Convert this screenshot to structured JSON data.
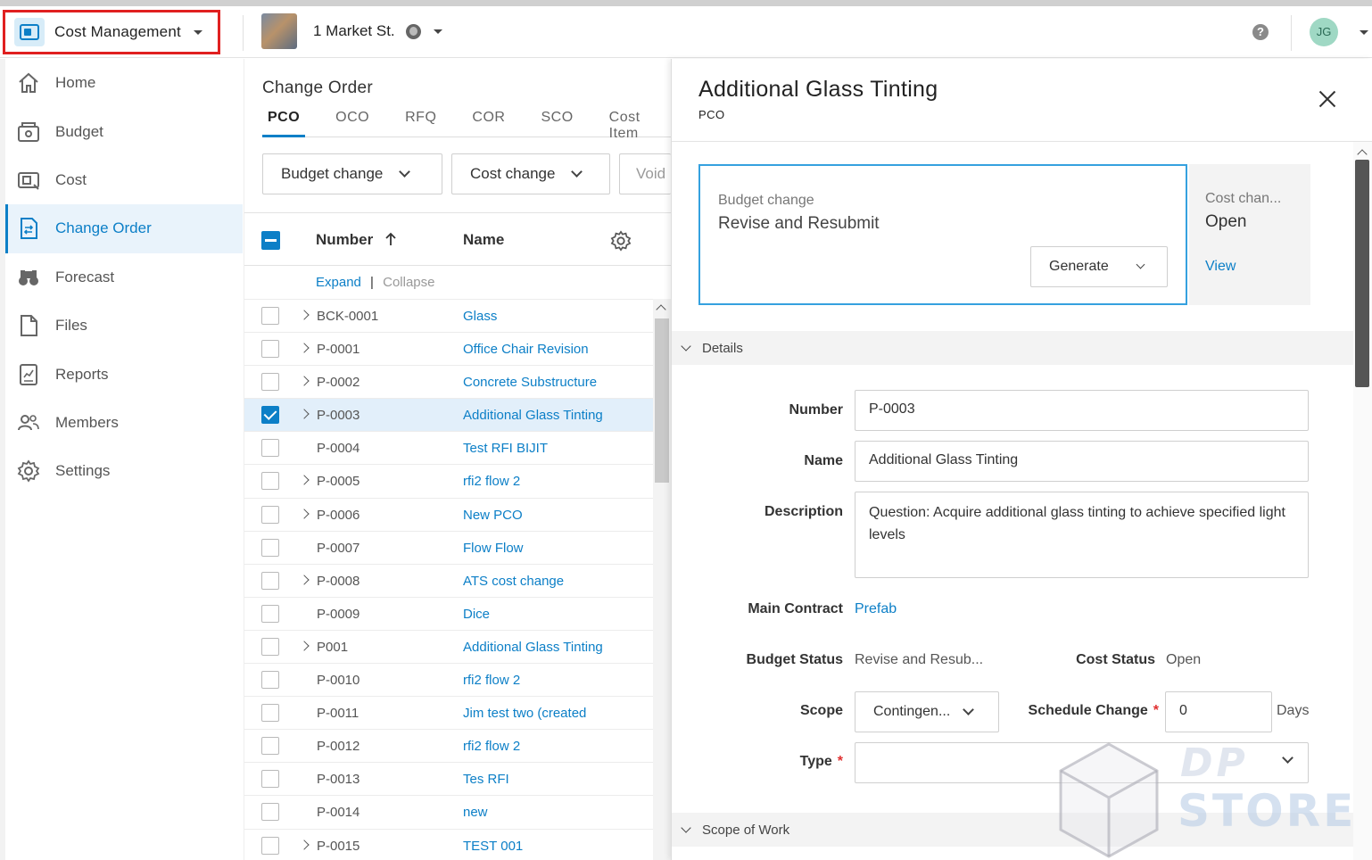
{
  "app": {
    "title": "Cost Management",
    "icon": "cost-management-icon"
  },
  "project": {
    "name": "1 Market St."
  },
  "user": {
    "initials": "JG"
  },
  "sidebar": {
    "items": [
      {
        "label": "Home",
        "icon": "home-icon"
      },
      {
        "label": "Budget",
        "icon": "budget-icon"
      },
      {
        "label": "Cost",
        "icon": "cost-icon"
      },
      {
        "label": "Change Order",
        "icon": "change-order-icon",
        "active": true
      },
      {
        "label": "Forecast",
        "icon": "forecast-icon"
      },
      {
        "label": "Files",
        "icon": "files-icon"
      },
      {
        "label": "Reports",
        "icon": "reports-icon"
      },
      {
        "label": "Members",
        "icon": "members-icon"
      },
      {
        "label": "Settings",
        "icon": "settings-icon"
      }
    ]
  },
  "list": {
    "title": "Change Order",
    "tabs": [
      "PCO",
      "OCO",
      "RFQ",
      "COR",
      "SCO",
      "Cost Item"
    ],
    "active_tab": "PCO",
    "filters": {
      "budget_change": "Budget change",
      "cost_change": "Cost change",
      "void": "Void"
    },
    "columns": {
      "number": "Number",
      "name": "Name"
    },
    "expand": "Expand",
    "separator": "|",
    "collapse": "Collapse",
    "rows": [
      {
        "number": "BCK-0001",
        "name": "Glass",
        "expandable": true,
        "selected": false
      },
      {
        "number": "P-0001",
        "name": "Office Chair Revision",
        "expandable": true,
        "selected": false
      },
      {
        "number": "P-0002",
        "name": "Concrete Substructure",
        "expandable": true,
        "selected": false
      },
      {
        "number": "P-0003",
        "name": "Additional Glass Tinting",
        "expandable": true,
        "selected": true
      },
      {
        "number": "P-0004",
        "name": "Test RFI BIJIT",
        "expandable": false,
        "selected": false
      },
      {
        "number": "P-0005",
        "name": "rfi2 flow 2",
        "expandable": true,
        "selected": false
      },
      {
        "number": "P-0006",
        "name": "New PCO",
        "expandable": true,
        "selected": false
      },
      {
        "number": "P-0007",
        "name": "Flow Flow",
        "expandable": false,
        "selected": false
      },
      {
        "number": "P-0008",
        "name": "ATS cost change",
        "expandable": true,
        "selected": false
      },
      {
        "number": "P-0009",
        "name": "Dice",
        "expandable": false,
        "selected": false
      },
      {
        "number": "P001",
        "name": "Additional Glass Tinting",
        "expandable": true,
        "selected": false
      },
      {
        "number": "P-0010",
        "name": "rfi2 flow 2",
        "expandable": false,
        "selected": false
      },
      {
        "number": "P-0011",
        "name": "Jim test two (created",
        "expandable": false,
        "selected": false
      },
      {
        "number": "P-0012",
        "name": "rfi2 flow 2",
        "expandable": false,
        "selected": false
      },
      {
        "number": "P-0013",
        "name": "Tes RFI",
        "expandable": false,
        "selected": false
      },
      {
        "number": "P-0014",
        "name": "new",
        "expandable": false,
        "selected": false
      },
      {
        "number": "P-0015",
        "name": "TEST 001",
        "expandable": true,
        "selected": false
      }
    ]
  },
  "detail": {
    "title": "Additional Glass Tinting",
    "subtitle": "PCO",
    "budget_card": {
      "label": "Budget change",
      "status": "Revise and Resubmit",
      "generate_label": "Generate"
    },
    "cost_card": {
      "label": "Cost chan...",
      "status": "Open",
      "view_label": "View"
    },
    "details_section": "Details",
    "scope_of_work_section": "Scope of Work",
    "fields": {
      "number_label": "Number",
      "number_value": "P-0003",
      "name_label": "Name",
      "name_value": "Additional Glass Tinting",
      "description_label": "Description",
      "description_value": "Question: Acquire additional glass tinting to achieve specified light levels",
      "main_contract_label": "Main Contract",
      "main_contract_value": "Prefab",
      "budget_status_label": "Budget Status",
      "budget_status_value": "Revise and Resub...",
      "cost_status_label": "Cost Status",
      "cost_status_value": "Open",
      "scope_label": "Scope",
      "scope_value": "Contingen...",
      "schedule_change_label": "Schedule Change",
      "schedule_change_value": "0",
      "schedule_change_unit": "Days",
      "type_label": "Type",
      "type_value": "",
      "required_mark": "*"
    }
  },
  "watermark": {
    "line1": "DP",
    "line2": "STORE"
  },
  "colors": {
    "accent": "#0c7fc7",
    "highlight_border": "#e02020",
    "selected_row": "#e2effa",
    "card_border": "#35a1df"
  }
}
